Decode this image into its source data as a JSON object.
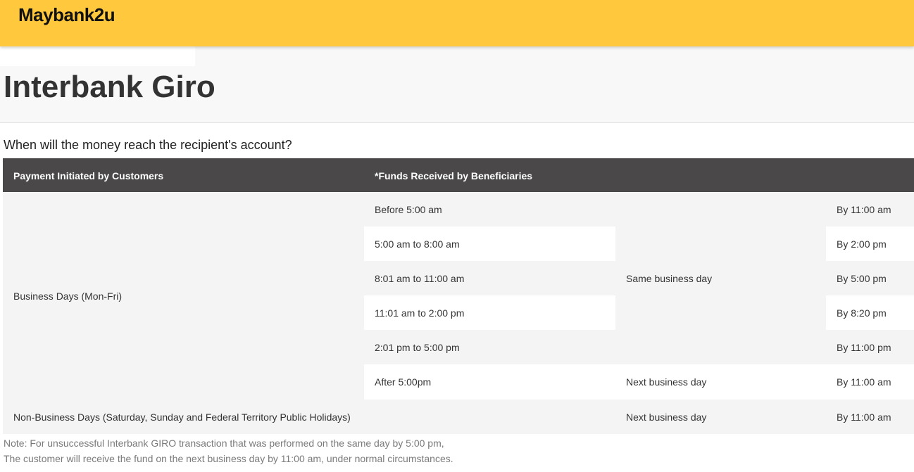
{
  "header": {
    "logo": "Maybank2u",
    "accent_color": "#ffc83d"
  },
  "page": {
    "title": "Interbank Giro",
    "question": "When will the money reach the recipient's account?"
  },
  "table": {
    "header_bg": "#4a4848",
    "columns": [
      "Payment Initiated by Customers",
      "*Funds Received by Beneficiaries"
    ],
    "business_days_label": "Business Days (Mon-Fri)",
    "non_business_days_label": "Non-Business Days (Saturday, Sunday and Federal Territory Public Holidays)",
    "same_day_label": "Same business day",
    "next_day_label": "Next business day",
    "rows": [
      {
        "initiated": "Before 5:00 am",
        "received": "By 11:00 am"
      },
      {
        "initiated": "5:00 am to 8:00 am",
        "received": "By 2:00 pm"
      },
      {
        "initiated": "8:01 am to 11:00 am",
        "received": "By 5:00 pm"
      },
      {
        "initiated": "11:01 am to 2:00 pm",
        "received": "By 8:20 pm"
      },
      {
        "initiated": "2:01 pm to 5:00 pm",
        "received": "By 11:00 pm"
      },
      {
        "initiated": "After 5:00pm",
        "received": "By 11:00 am"
      }
    ],
    "non_business_row": {
      "day": "Next business day",
      "received": "By 11:00 am"
    }
  },
  "notes": [
    "Note: For unsuccessful Interbank GIRO transaction that was performed on the same day by 5:00 pm,",
    "The customer will receive the fund on the next business day by 11:00 am, under normal circumstances."
  ]
}
